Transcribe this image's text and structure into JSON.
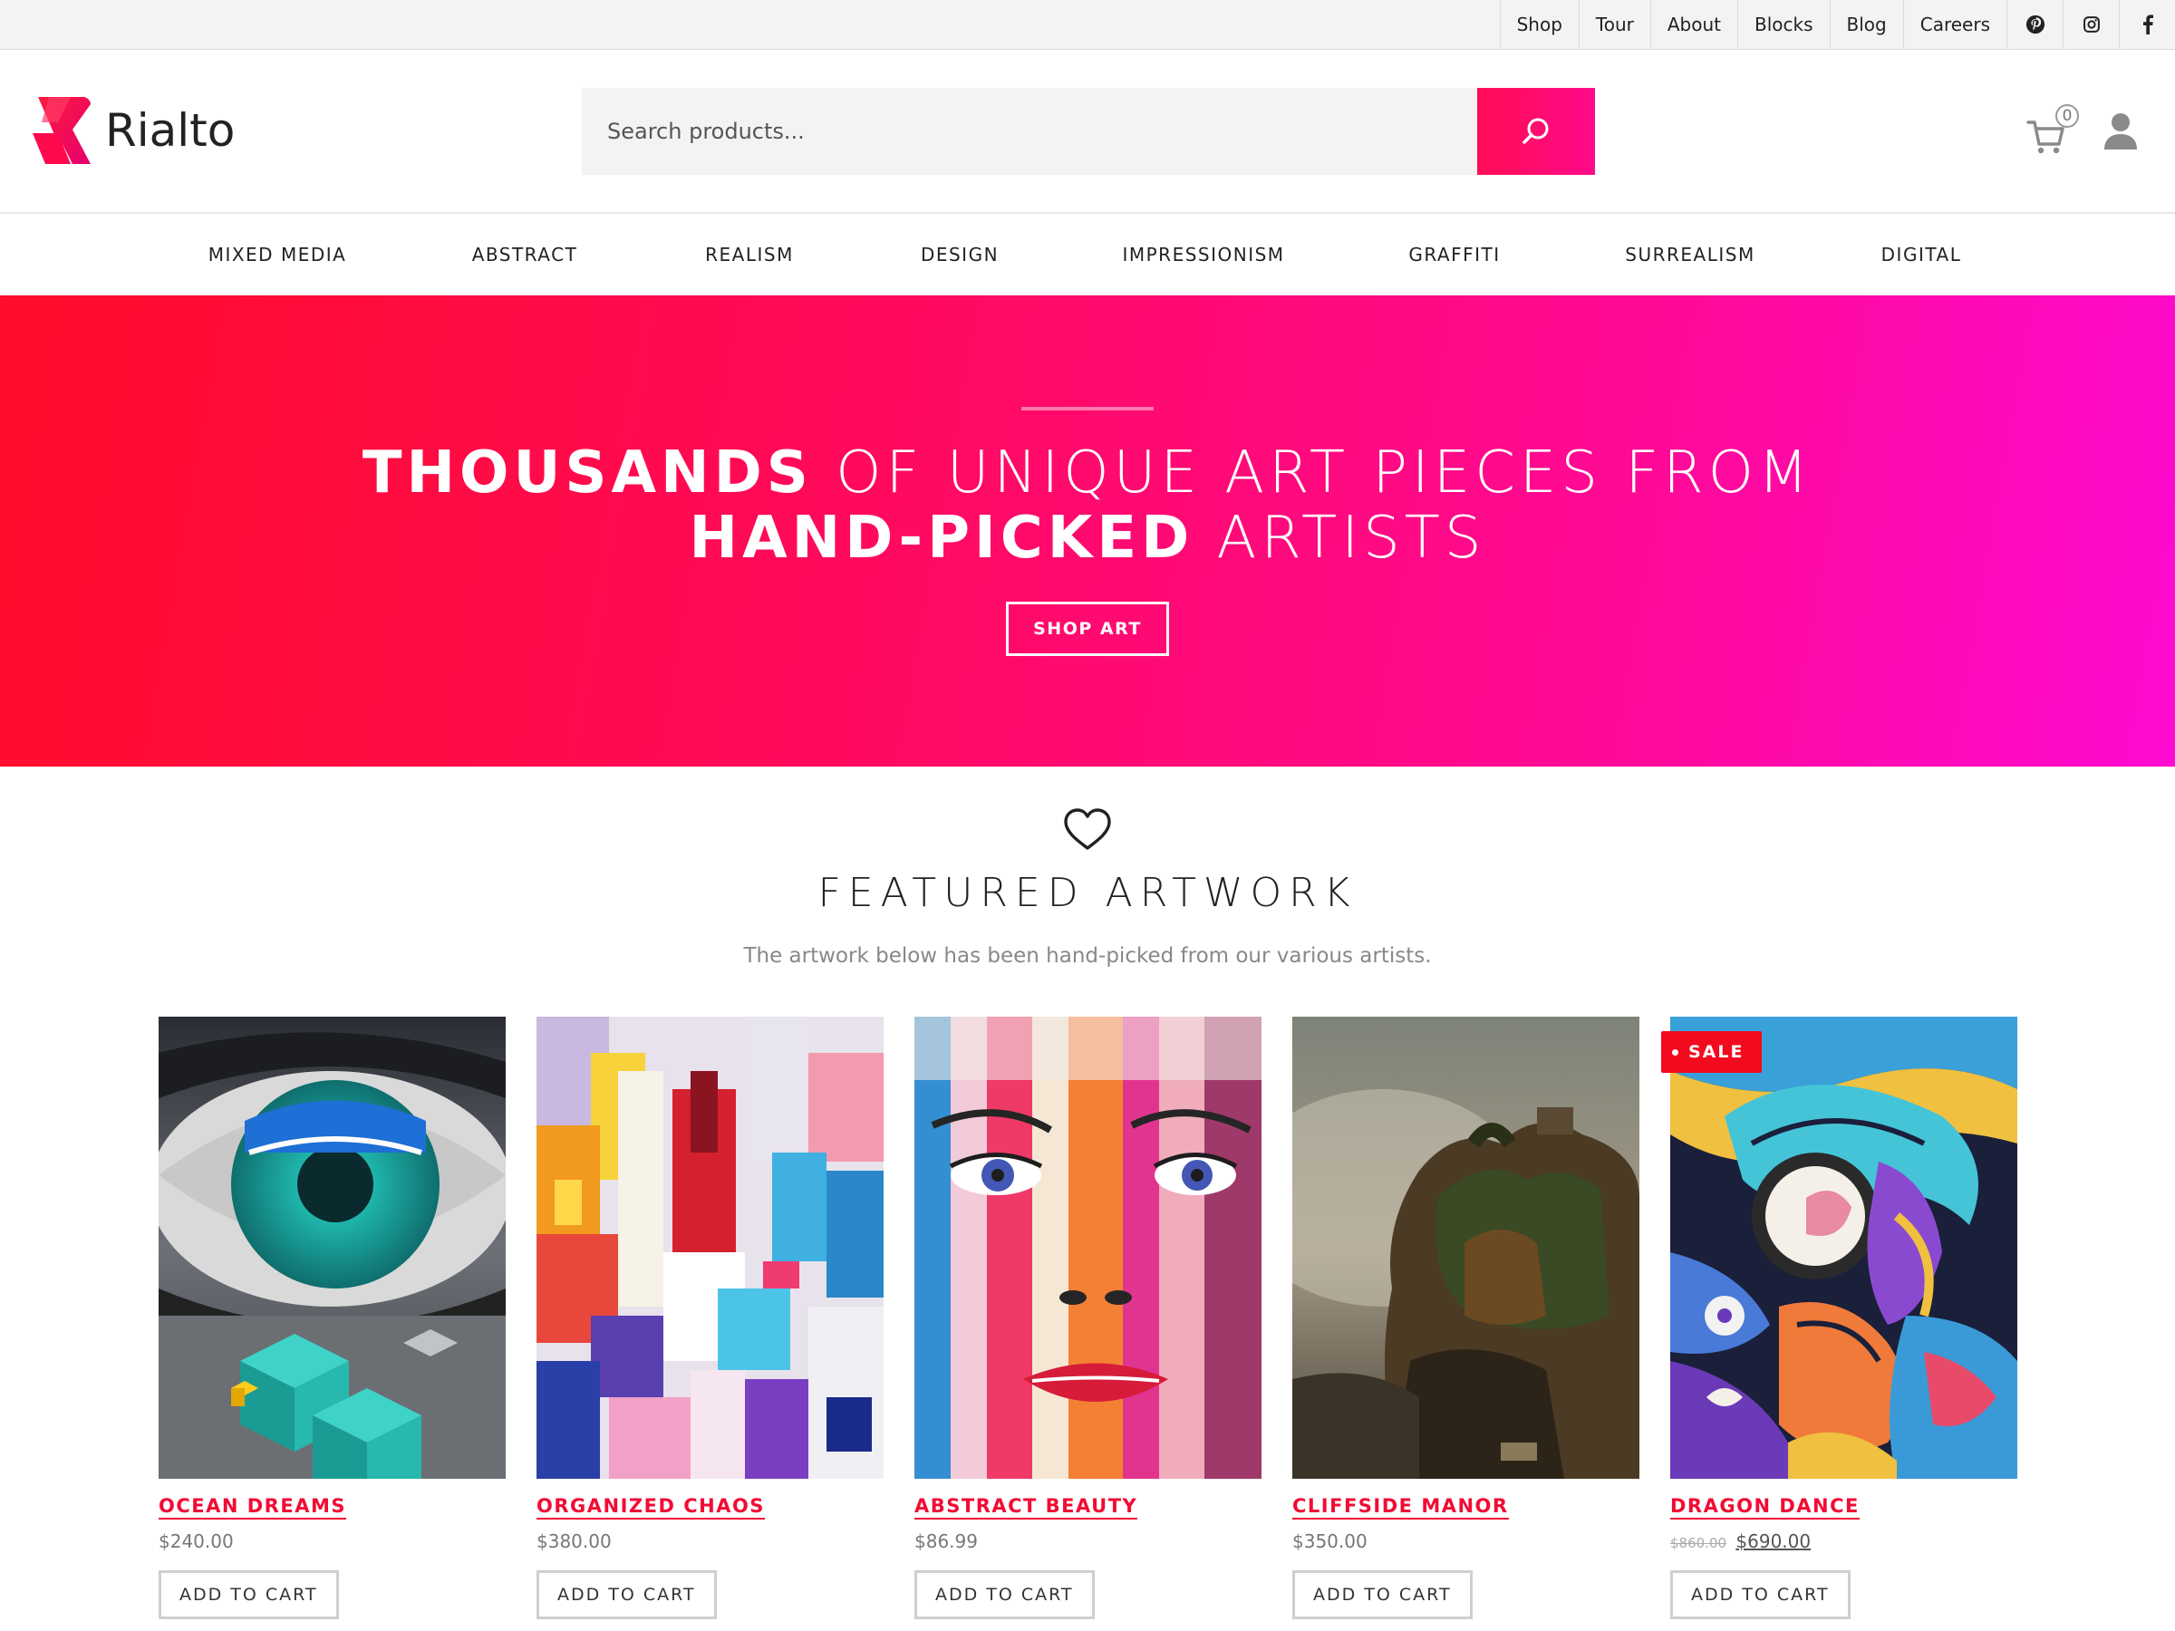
{
  "topbar": {
    "links": [
      "Shop",
      "Tour",
      "About",
      "Blocks",
      "Blog",
      "Careers"
    ],
    "social": [
      "pinterest-icon",
      "instagram-icon",
      "facebook-icon"
    ]
  },
  "header": {
    "logo_text": "Rialto",
    "search_placeholder": "Search products...",
    "cart_count": "0"
  },
  "categories": [
    "MIXED MEDIA",
    "ABSTRACT",
    "REALISM",
    "DESIGN",
    "IMPRESSIONISM",
    "GRAFFITI",
    "SURREALISM",
    "DIGITAL"
  ],
  "hero": {
    "line1_bold": "THOUSANDS",
    "line1_rest": " OF UNIQUE ART PIECES FROM",
    "line2_bold": "HAND-PICKED",
    "line2_rest": " ARTISTS",
    "button": "SHOP ART"
  },
  "featured": {
    "title": "FEATURED ARTWORK",
    "subtitle": "The artwork below has been hand-picked from our various artists."
  },
  "products": [
    {
      "name": "OCEAN DREAMS",
      "price": "$240.00",
      "button": "ADD TO CART"
    },
    {
      "name": "ORGANIZED CHAOS",
      "price": "$380.00",
      "button": "ADD TO CART"
    },
    {
      "name": "ABSTRACT BEAUTY",
      "price": "$86.99",
      "button": "ADD TO CART"
    },
    {
      "name": "CLIFFSIDE MANOR",
      "price": "$350.00",
      "button": "ADD TO CART"
    },
    {
      "name": "DRAGON DANCE",
      "old_price": "$860.00",
      "price": "$690.00",
      "button": "ADD TO CART",
      "badge": "SALE"
    }
  ],
  "colors": {
    "accent": "#f20b34",
    "hero_start": "#ff0d2a",
    "hero_end": "#ff0ad2"
  }
}
